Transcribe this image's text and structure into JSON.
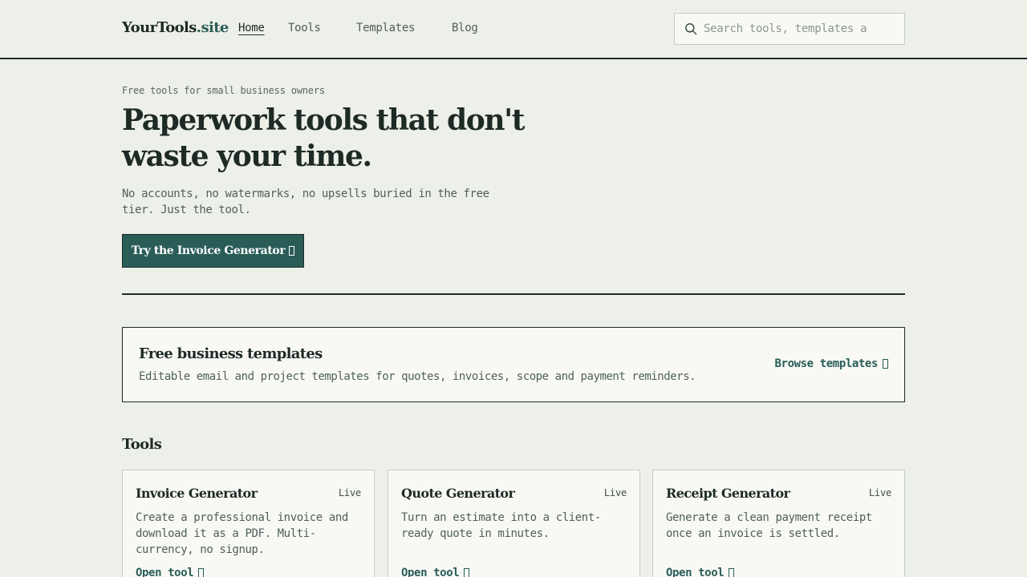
{
  "header": {
    "logo_main": "YourTools",
    "logo_suffix": ".site",
    "nav": [
      {
        "label": "Home",
        "active": true
      },
      {
        "label": "Tools",
        "active": false
      },
      {
        "label": "Templates",
        "active": false
      },
      {
        "label": "Blog",
        "active": false
      }
    ],
    "search": {
      "placeholder": "Search tools, templates a",
      "icon": "search-icon"
    }
  },
  "hero": {
    "eyebrow": "Free tools for small business owners",
    "title": "Paperwork tools that don't waste your time.",
    "subtitle": "No accounts, no watermarks, no upsells buried in the free tier. Just the tool.",
    "cta_label": "Try the Invoice Generator",
    "cta_icon": "arrow-glyph"
  },
  "templates_banner": {
    "title": "Free business templates",
    "description": "Editable email and project templates for quotes, invoices, scope and payment reminders.",
    "link_label": "Browse templates",
    "link_icon": "arrow-glyph"
  },
  "tools": {
    "section_title": "Tools",
    "cards": [
      {
        "title": "Invoice Generator",
        "badge": "Live",
        "description": "Create a professional invoice and download it as a PDF. Multi-currency, no signup.",
        "link_label": "Open tool"
      },
      {
        "title": "Quote Generator",
        "badge": "Live",
        "description": "Turn an estimate into a client-ready quote in minutes.",
        "link_label": "Open tool"
      },
      {
        "title": "Receipt Generator",
        "badge": "Live",
        "description": "Generate a clean payment receipt once an invoice is settled.",
        "link_label": "Open tool"
      }
    ]
  },
  "colors": {
    "background": "#edf0e9",
    "ink": "#1e2a25",
    "accent": "#2a5d57",
    "muted": "#50605a",
    "card_bg": "#f8f9f5"
  }
}
